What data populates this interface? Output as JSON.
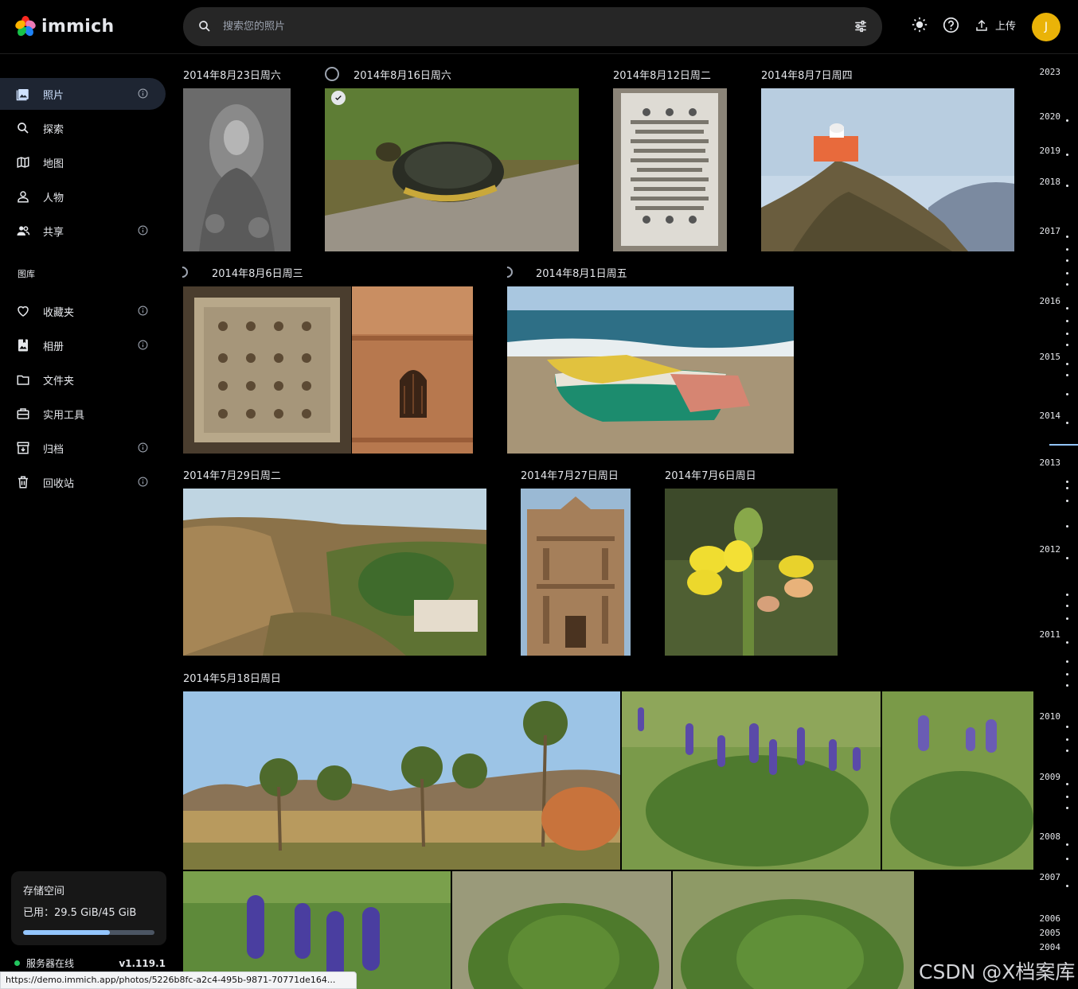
{
  "app": {
    "name": "immich"
  },
  "header": {
    "search_placeholder": "搜索您的照片",
    "upload_label": "上传",
    "avatar_initial": "J"
  },
  "sidebar": {
    "items": [
      {
        "label": "照片",
        "icon": "photos-icon",
        "info": true
      },
      {
        "label": "探索",
        "icon": "search-icon",
        "info": false
      },
      {
        "label": "地图",
        "icon": "map-icon",
        "info": false
      },
      {
        "label": "人物",
        "icon": "person-icon",
        "info": false
      },
      {
        "label": "共享",
        "icon": "people-icon",
        "info": true
      }
    ],
    "library_label": "图库",
    "library_items": [
      {
        "label": "收藏夹",
        "icon": "heart-icon",
        "info": true
      },
      {
        "label": "相册",
        "icon": "album-icon",
        "info": true
      },
      {
        "label": "文件夹",
        "icon": "folder-icon",
        "info": false
      },
      {
        "label": "实用工具",
        "icon": "toolbox-icon",
        "info": false
      },
      {
        "label": "归档",
        "icon": "archive-icon",
        "info": true
      },
      {
        "label": "回收站",
        "icon": "trash-icon",
        "info": true
      }
    ],
    "storage": {
      "title": "存储空间",
      "used": "已用：29.5 GiB/45 GiB",
      "used_fraction": 0.66
    },
    "server_status": "服务器在线",
    "server_version": "v1.119.1"
  },
  "timeline": {
    "groups": [
      {
        "date": "2014年8月23日周六"
      },
      {
        "date": "2014年8月16日周六"
      },
      {
        "date": "2014年8月12日周二"
      },
      {
        "date": "2014年8月7日周四"
      },
      {
        "date": "2014年8月6日周三"
      },
      {
        "date": "2014年8月1日周五"
      },
      {
        "date": "2014年7月29日周二"
      },
      {
        "date": "2014年7月27日周日"
      },
      {
        "date": "2014年7月6日周日"
      },
      {
        "date": "2014年5月18日周日"
      }
    ]
  },
  "scrubber": {
    "years": [
      "2023",
      "2020",
      "2019",
      "2018",
      "2017",
      "2016",
      "2015",
      "2014",
      "2013",
      "2012",
      "2011",
      "2010",
      "2009",
      "2008",
      "2007",
      "2006",
      "2005",
      "2004"
    ]
  },
  "status_url": "https://demo.immich.app/photos/5226b8fc-a2c4-495b-9871-70771de164...",
  "watermark": "CSDN @X档案库",
  "colors": {
    "accent": "#93c5fd",
    "avatar": "#eab308",
    "online": "#22c55e"
  }
}
